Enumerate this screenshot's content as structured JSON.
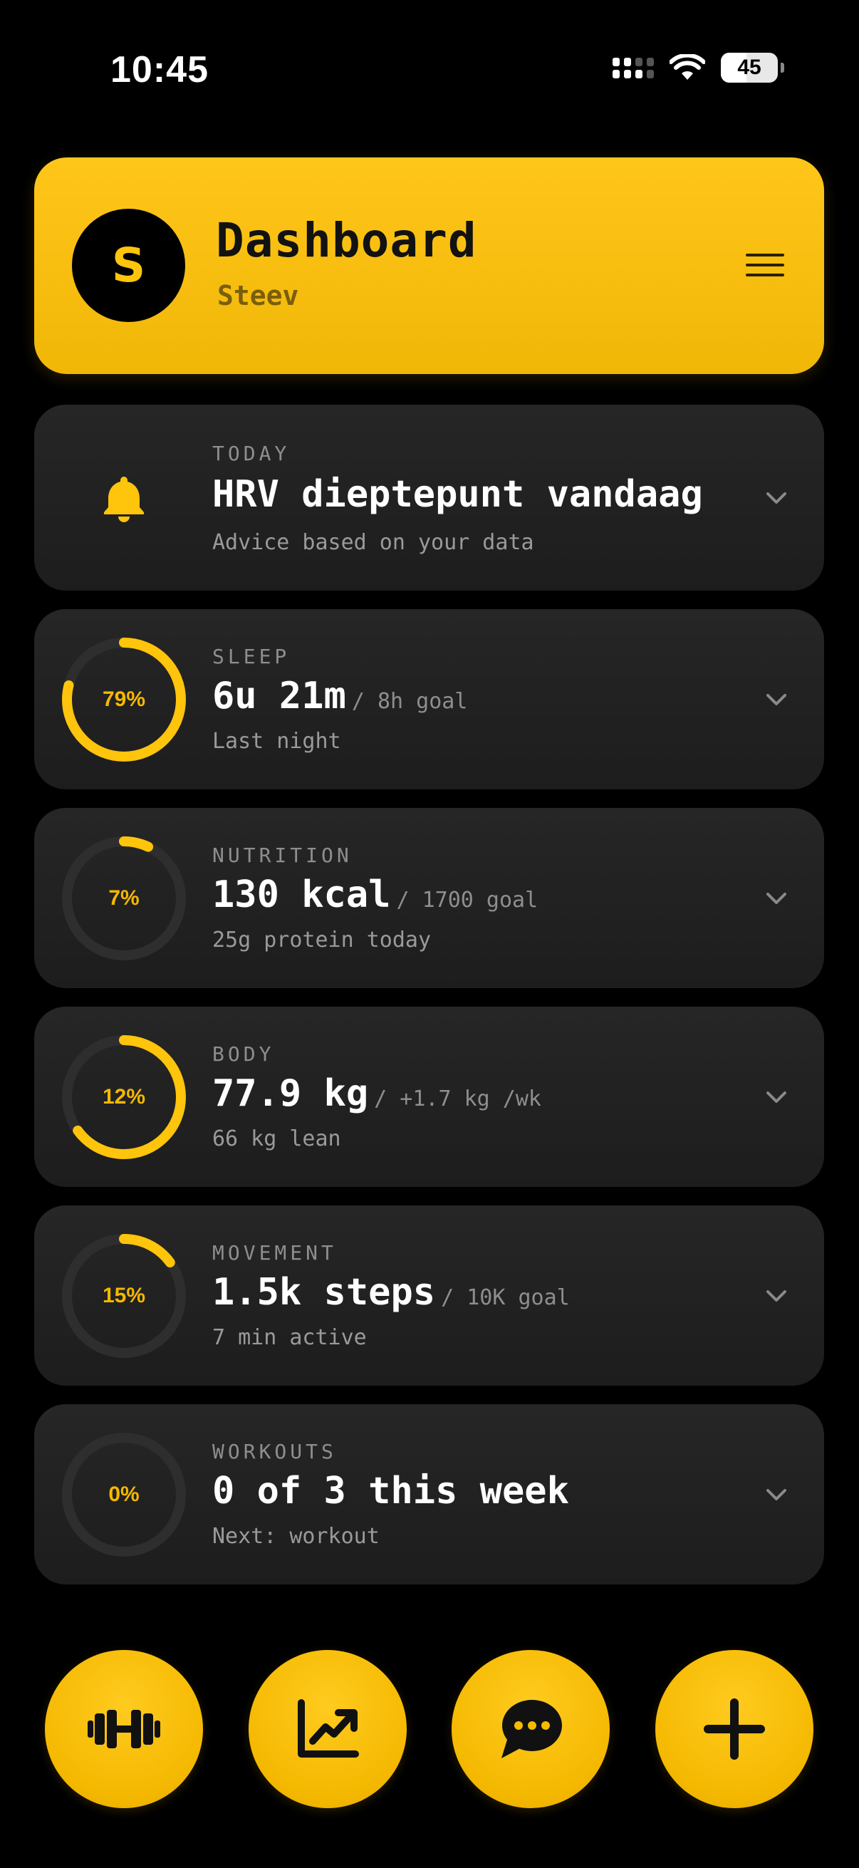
{
  "status_bar": {
    "time": "10:45",
    "battery": "45",
    "battery_level": 0.45
  },
  "header": {
    "avatar_initial": "S",
    "title": "Dashboard",
    "subtitle": "Steev",
    "menu_icon": "hamburger-menu-icon"
  },
  "accent_color": "#FFC40C",
  "cards": [
    {
      "key": "today",
      "label": "TODAY",
      "main": "HRV dieptepunt vandaag",
      "goal": "",
      "sub": "Advice based on your data",
      "icon": "bell-icon"
    },
    {
      "key": "sleep",
      "label": "SLEEP",
      "main": "6u 21m",
      "goal": "/ 8h goal",
      "sub": "Last night",
      "percent_label": "79%",
      "progress": 0.79
    },
    {
      "key": "nutrition",
      "label": "NUTRITION",
      "main": "130 kcal",
      "goal": "/ 1700 goal",
      "sub": "25g protein today",
      "percent_label": "7%",
      "progress": 0.07
    },
    {
      "key": "body",
      "label": "BODY",
      "main": "77.9 kg",
      "goal": "/ +1.7 kg /wk",
      "sub": "66 kg lean",
      "percent_label": "12%",
      "progress": 0.65
    },
    {
      "key": "movement",
      "label": "MOVEMENT",
      "main": "1.5k steps",
      "goal": "/ 10K goal",
      "sub": "7 min active",
      "percent_label": "15%",
      "progress": 0.15
    },
    {
      "key": "workouts",
      "label": "WORKOUTS",
      "main": "0 of 3 this week",
      "goal": "",
      "sub": "Next: workout",
      "percent_label": "0%",
      "progress": 0
    }
  ],
  "bottom_nav": [
    {
      "name": "workout-button",
      "icon": "dumbbell-icon"
    },
    {
      "name": "progress-chart-button",
      "icon": "trend-chart-icon"
    },
    {
      "name": "chat-button",
      "icon": "chat-bubble-icon"
    },
    {
      "name": "add-button",
      "icon": "plus-icon"
    }
  ]
}
